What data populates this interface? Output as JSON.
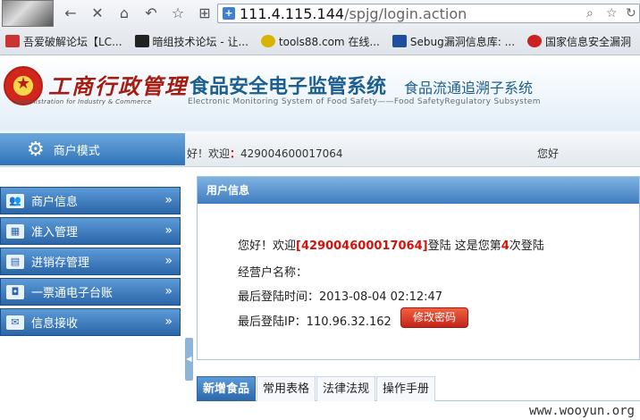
{
  "browser": {
    "url_host": "111.4.115.144",
    "url_path": "/spjg/login.action",
    "bookmarks": [
      {
        "label": "吾爱破解论坛【LC...",
        "color": "#c33"
      },
      {
        "label": "暗组技术论坛 - 让...",
        "color": "#222"
      },
      {
        "label": "tools88.com 在线...",
        "color": "#d8b400"
      },
      {
        "label": "Sebug漏洞信息库: ...",
        "color": "#1d4f9e"
      },
      {
        "label": "国家信息安全漏洞",
        "color": "#c22"
      }
    ]
  },
  "header": {
    "calligraphy": "工商行政管理",
    "admin_en": "Administration for Industry & Commerce",
    "title": "食品安全电子监管系统",
    "subtitle": "食品流通追溯子系统",
    "title_en": "Electronic Monitoring System of Food Safety——Food SafetyRegulatory Subsystem"
  },
  "modebar": {
    "mode_label": "商户模式",
    "welcome_text": "好！欢迎",
    "welcome_colon": "：",
    "user_id": "429004600017064",
    "right_greeting": "您好"
  },
  "sidebar": {
    "items": [
      {
        "label": "商户信息",
        "icon": "👥",
        "arrow": "»"
      },
      {
        "label": "准入管理",
        "icon": "▦",
        "arrow": "»"
      },
      {
        "label": "进销存管理",
        "icon": "▤",
        "arrow": "»"
      },
      {
        "label": "一票通电子台账",
        "icon": "◘",
        "arrow": "»"
      },
      {
        "label": "信息接收",
        "icon": "✉",
        "arrow": "»"
      }
    ],
    "collapse_glyph": "◀"
  },
  "panel": {
    "title": "用户信息",
    "greet_prefix": "您好！欢迎",
    "user_bracket": "[429004600017064]",
    "greet_mid": "登陆 这是您第",
    "login_count": "4",
    "greet_suffix": "次登陆",
    "business_name_label": "经营户名称：",
    "last_login_time": "最后登陆时间：2013-08-04 02:12:47",
    "last_login_ip": "最后登陆IP：110.96.32.162",
    "change_password": "修改密码"
  },
  "tabs": [
    {
      "label": "新增食品",
      "active": true
    },
    {
      "label": "常用表格",
      "active": false
    },
    {
      "label": "法律法规",
      "active": false
    },
    {
      "label": "操作手册",
      "active": false
    }
  ],
  "watermark": "www.wooyun.org"
}
